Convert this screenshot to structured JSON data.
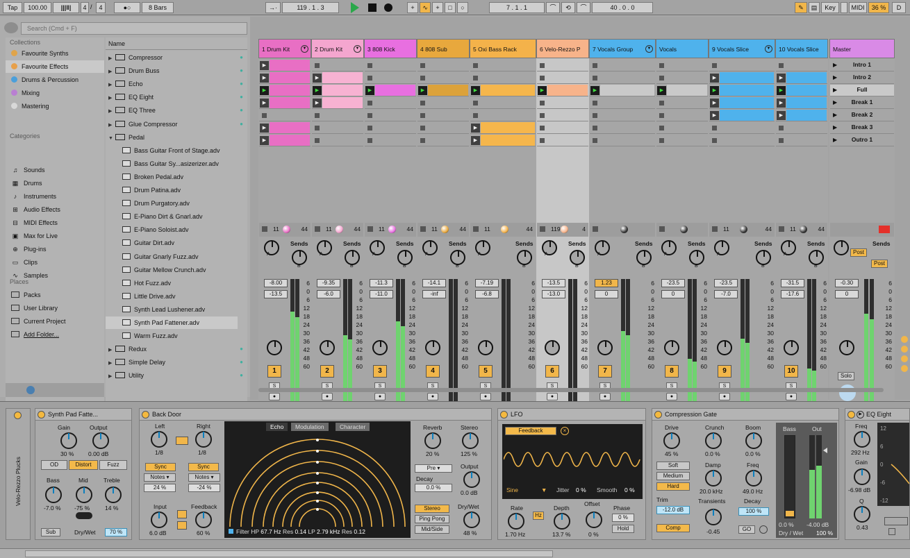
{
  "transport": {
    "tap": "Tap",
    "tempo": "100.00",
    "signature_num": "4",
    "signature_sep": "/",
    "signature_den": "4",
    "loop_icon": "●○",
    "quantize": "8 Bars",
    "position": "119 .   1 .   3",
    "loop_start": "7 .   1 .   1",
    "loop_length": "40 .   0 .   0",
    "key_label": "Key",
    "midi_label": "MIDI",
    "cpu": "36 %",
    "d_label": "D"
  },
  "browser": {
    "search_placeholder": "Search (Cmd + F)",
    "collections_title": "Collections",
    "collections": [
      {
        "label": "Favourite Synths",
        "color": "#e0a44a"
      },
      {
        "label": "Favourite Effects",
        "color": "#e7a04a"
      },
      {
        "label": "Drums & Percussion",
        "color": "#4a9fdb"
      },
      {
        "label": "Mixing",
        "color": "#b97fd2"
      },
      {
        "label": "Mastering",
        "color": "#d8d8d8"
      }
    ],
    "categories_title": "Categories",
    "categories": [
      "Sounds",
      "Drums",
      "Instruments",
      "Audio Effects",
      "MIDI Effects",
      "Max for Live",
      "Plug-ins",
      "Clips",
      "Samples"
    ],
    "places_title": "Places",
    "places": [
      "Packs",
      "User Library",
      "Current Project",
      "Add Folder..."
    ],
    "name_header": "Name",
    "items": [
      {
        "label": "Compressor",
        "type": "folder"
      },
      {
        "label": "Drum Buss",
        "type": "folder"
      },
      {
        "label": "Echo",
        "type": "folder"
      },
      {
        "label": "EQ Eight",
        "type": "folder"
      },
      {
        "label": "EQ Three",
        "type": "folder"
      },
      {
        "label": "Glue Compressor",
        "type": "folder"
      },
      {
        "label": "Pedal",
        "type": "folder-open"
      },
      {
        "label": "Bass Guitar Front of Stage.adv",
        "type": "file"
      },
      {
        "label": "Bass Guitar Sy...asizerizer.adv",
        "type": "file"
      },
      {
        "label": "Broken Pedal.adv",
        "type": "file"
      },
      {
        "label": "Drum Patina.adv",
        "type": "file"
      },
      {
        "label": "Drum Purgatory.adv",
        "type": "file"
      },
      {
        "label": "E-Piano Dirt & Gnarl.adv",
        "type": "file"
      },
      {
        "label": "E-Piano Soloist.adv",
        "type": "file"
      },
      {
        "label": "Guitar Dirt.adv",
        "type": "file"
      },
      {
        "label": "Guitar Gnarly Fuzz.adv",
        "type": "file"
      },
      {
        "label": "Guitar Mellow Crunch.adv",
        "type": "file"
      },
      {
        "label": "Hot Fuzz.adv",
        "type": "file"
      },
      {
        "label": "Little Drive.adv",
        "type": "file"
      },
      {
        "label": "Synth Lead Lushener.adv",
        "type": "file"
      },
      {
        "label": "Synth Pad Fattener.adv",
        "type": "file"
      },
      {
        "label": "Warm Fuzz.adv",
        "type": "file"
      },
      {
        "label": "Redux",
        "type": "folder"
      },
      {
        "label": "Simple Delay",
        "type": "folder"
      },
      {
        "label": "Utility",
        "type": "folder"
      }
    ]
  },
  "tracks": [
    {
      "name": "1 Drum Kit",
      "color": "#e86fc4",
      "fill": "#e86fc4",
      "number": "1",
      "vol": "-8.00",
      "pan": "-13.5",
      "in": "11",
      "out": "44",
      "clips": [
        1,
        1,
        1,
        1,
        0,
        1,
        1
      ],
      "meter": 0.78
    },
    {
      "name": "2 Drum Kit",
      "color": "#f4a6cf",
      "fill": "#f7b2d2",
      "number": "2",
      "vol": "-9.35",
      "pan": "-6.0",
      "in": "11",
      "out": "44",
      "clips": [
        0,
        1,
        1,
        1,
        0,
        0,
        0
      ],
      "meter": 0.58
    },
    {
      "name": "3 808 Kick",
      "color": "#e86fe0",
      "fill": "#e86fe0",
      "number": "3",
      "vol": "-11.3",
      "pan": "-11.0",
      "in": "11",
      "out": "44",
      "clips": [
        0,
        0,
        1,
        0,
        0,
        0,
        0
      ],
      "meter": 0.7
    },
    {
      "name": "4 808 Sub",
      "color": "#e8a83d",
      "fill": "#dca23a",
      "number": "4",
      "vol": "-14.1",
      "pan": "-inf",
      "in": "11",
      "out": "44",
      "clips": [
        0,
        0,
        1,
        0,
        0,
        0,
        0
      ],
      "meter": 0.0
    },
    {
      "name": "5 Oxi Bass Rack",
      "color": "#f4b24a",
      "fill": "#f5b64c",
      "number": "5",
      "vol": "-7.19",
      "pan": "-6.8",
      "in": "11",
      "out": "44",
      "clips": [
        0,
        0,
        1,
        0,
        0,
        1,
        1
      ],
      "meter": 0.0
    },
    {
      "name": "6 Velo-Rezzo P",
      "color": "#f7b38a",
      "fill": "#f7b38a",
      "number": "6",
      "vol": "-13.5",
      "pan": "-13.0",
      "in": "119",
      "out": "4",
      "clips": [
        0,
        0,
        1,
        0,
        0,
        0,
        0
      ],
      "meter": 0.0
    },
    {
      "name": "7 Vocals Group",
      "color": "#4fb2ec",
      "fill": "#c9c9c9",
      "number": "7",
      "vol": "1.23",
      "pan": "0",
      "in": "",
      "out": "",
      "clips": [
        0,
        0,
        1,
        0,
        0,
        0,
        0
      ],
      "meter": 0.62
    },
    {
      "name": "Vocals",
      "color": "#4fb2ec",
      "fill": "#c9c9c9",
      "number": "8",
      "vol": "-23.5",
      "pan": "0",
      "in": "",
      "out": "",
      "clips": [
        0,
        0,
        1,
        0,
        0,
        0,
        0
      ],
      "meter": 0.38
    },
    {
      "name": "9 Vocals Slice",
      "color": "#4fb2ec",
      "fill": "#4fb2ec",
      "number": "9",
      "vol": "-23.5",
      "pan": "-7.0",
      "in": "11",
      "out": "44",
      "clips": [
        0,
        1,
        1,
        1,
        1,
        0,
        0
      ],
      "meter": 0.55
    },
    {
      "name": "10 Vocals Slice",
      "color": "#4fb2ec",
      "fill": "#4fb2ec",
      "number": "10",
      "vol": "-31.5",
      "pan": "-17.6",
      "in": "11",
      "out": "44",
      "clips": [
        0,
        1,
        1,
        1,
        1,
        0,
        0
      ],
      "meter": 0.3
    }
  ],
  "master": {
    "name": "Master",
    "scenes": [
      "Intro 1",
      "Intro 2",
      "Full",
      "Break 1",
      "Break 2",
      "Break 3",
      "Outro 1"
    ],
    "vol": "-0.30",
    "pan": "0",
    "solo": "Solo",
    "post1": "Post",
    "post2": "Post",
    "meter": 0.72
  },
  "mixer": {
    "sends": "Sends",
    "send_a": "A",
    "send_b": "B",
    "solo": "S",
    "scale": [
      "6",
      "0",
      "6",
      "12",
      "18",
      "24",
      "30",
      "36",
      "42",
      "48",
      "60"
    ]
  },
  "devices": {
    "chain_label": "Velo-Rezzo Plucks",
    "synth_pad": {
      "title": "Synth Pad Fatte...",
      "gain_label": "Gain",
      "gain_val": "30 %",
      "output_label": "Output",
      "output_val": "0.00 dB",
      "od": "OD",
      "distort": "Distort",
      "fuzz": "Fuzz",
      "bass_label": "Bass",
      "bass_val": "-7.0 %",
      "mid_label": "Mid",
      "mid_val": "-75 %",
      "treble_label": "Treble",
      "treble_val": "14 %",
      "sub": "Sub",
      "drywet_label": "Dry/Wet",
      "drywet_val": "70 %"
    },
    "back_door": {
      "title": "Back Door",
      "left_label": "Left",
      "left_val": "1/8",
      "right_label": "Right",
      "right_val": "1/8",
      "sync_l": "Sync",
      "sync_r": "Sync",
      "notes_l": "Notes ▾",
      "notes_r": "Notes ▾",
      "pct_l": "24 %",
      "pct_r": "-24 %",
      "input_label": "Input",
      "input_val": "6.0 dB",
      "feedback_label": "Feedback",
      "feedback_val": "60 %",
      "tabs": [
        "Echo",
        "Modulation",
        "Character"
      ],
      "filter_hp": "Filter HP",
      "hp_val": "67.7 Hz",
      "res1": "Res",
      "res1_val": "0.14",
      "lp": "LP",
      "lp_val": "2.79 kHz",
      "res2": "Res",
      "res2_val": "0.12",
      "reverb_label": "Reverb",
      "reverb_val": "20 %",
      "stereo_label": "Stereo",
      "stereo_val": "125 %",
      "pre": "Pre ▾",
      "decay_label": "Decay",
      "decay_val": "0.0 %",
      "output_label": "Output",
      "output_val": "0.0 dB",
      "stereo_btn": "Stereo",
      "pingpong": "Ping Pong",
      "midside": "Mid/Side",
      "drywet_label": "Dry/Wet",
      "drywet_val": "48 %"
    },
    "lfo": {
      "title": "LFO",
      "feedback": "Feedback",
      "wave": "Sine",
      "jitter_label": "Jitter",
      "jitter_val": "0 %",
      "smooth_label": "Smooth",
      "smooth_val": "0 %",
      "rate_label": "Rate",
      "rate_val": "1.70 Hz",
      "hz": "Hz",
      "depth_label": "Depth",
      "depth_val": "13.7 %",
      "offset_label": "Offset",
      "offset_val": "0 %",
      "phase_label": "Phase",
      "phase_val": "0 %",
      "hold": "Hold"
    },
    "comp_gate": {
      "title": "Compression Gate",
      "drive_label": "Drive",
      "drive_val": "45 %",
      "crunch_label": "Crunch",
      "crunch_val": "0.0 %",
      "boom_label": "Boom",
      "boom_val": "0.0 %",
      "soft": "Soft",
      "medium": "Medium",
      "hard": "Hard",
      "damp_label": "Damp",
      "damp_val": "20.0 kHz",
      "freq_label": "Freq",
      "freq_val": "49.0 Hz",
      "trim_label": "Trim",
      "trim_val": "-12.0 dB",
      "transients_label": "Transients",
      "transients_val": "-0.45",
      "decay_label": "Decay",
      "decay_val": "100 %",
      "comp": "Comp",
      "go": "GO",
      "bass_label": "Bass",
      "out_label": "Out",
      "bass_meter": "0.0 %",
      "out_meter": "-4.00 dB",
      "drywet": "Dry / Wet",
      "drywet_val": "100 %"
    },
    "eq_eight": {
      "title": "EQ Eight",
      "freq_label": "Freq",
      "freq_val": "292 Hz",
      "gain_label": "Gain",
      "gain_val": "-6.98 dB",
      "q_label": "Q",
      "q_val": "0.43",
      "db_scale": [
        "12",
        "6",
        "0",
        "-6",
        "-12"
      ]
    }
  }
}
